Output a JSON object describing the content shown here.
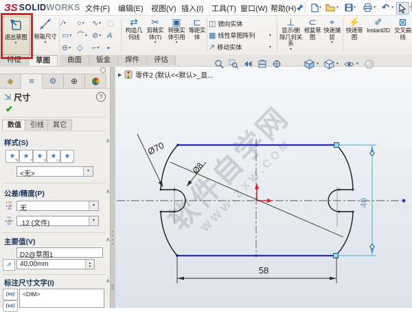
{
  "window": {
    "logo_script": "ЗS",
    "logo_solid": "SOLID",
    "logo_works": "WORKS"
  },
  "menus": {
    "items": [
      {
        "label": "文件(F)"
      },
      {
        "label": "编辑(E)"
      },
      {
        "label": "视图(V)"
      },
      {
        "label": "插入(I)"
      },
      {
        "label": "工具(T)"
      },
      {
        "label": "窗口(W)"
      },
      {
        "label": "帮助(H)"
      }
    ]
  },
  "ribbon": {
    "exit_sketch": {
      "label": "退出草图"
    },
    "smart_dim": {
      "label": "智能尺寸"
    },
    "entity_glyphs": {
      "r1": [
        "∕",
        "○",
        "∿",
        "▢"
      ],
      "r2": [
        "▭",
        "⌒",
        "⊘",
        "A"
      ],
      "r3": [
        "⊖",
        "◇",
        "⌐",
        "▪"
      ]
    },
    "tools": [
      {
        "label": "构造几何线",
        "glyph": "⇄"
      },
      {
        "label": "剪裁实体(T)",
        "glyph": "✂"
      },
      {
        "label": "转换实体引用",
        "glyph": "▣"
      },
      {
        "label": "等距实体",
        "glyph": "⊏"
      }
    ],
    "row_tools": [
      {
        "label": "镜向实体",
        "glyph": "◫"
      },
      {
        "label": "线性草图阵列",
        "glyph": "▦"
      },
      {
        "label": "移动实体",
        "glyph": "↗"
      }
    ],
    "right_tools": [
      {
        "label": "显示/删除几何关系",
        "glyph": "⊥"
      },
      {
        "label": "修复草图",
        "glyph": "⊂"
      },
      {
        "label": "快速捕捉",
        "glyph": "⌖"
      },
      {
        "label": "快速草图",
        "glyph": "⚡"
      },
      {
        "label": "Instant2D",
        "glyph": "✐"
      },
      {
        "label": "交叉曲线",
        "glyph": "⊠"
      }
    ],
    "tabs": [
      {
        "label": "特征"
      },
      {
        "label": "草图"
      },
      {
        "label": "曲面"
      },
      {
        "label": "钣金"
      },
      {
        "label": "焊件"
      },
      {
        "label": "评估"
      }
    ]
  },
  "panel": {
    "title": "尺寸",
    "help": "?",
    "ok": "✔",
    "tabs": [
      {
        "label": "数值"
      },
      {
        "label": "引线"
      },
      {
        "label": "其它"
      }
    ],
    "style": {
      "label": "样式(S)",
      "collapse": "∧",
      "dropdown": "<无>",
      "buttons": [
        {
          "badge": "✎"
        },
        {
          "badge": "+"
        },
        {
          "badge": "×"
        },
        {
          "badge": "▭"
        },
        {
          "badge": "↓"
        }
      ]
    },
    "tolerance": {
      "label": "公差/精度(P)",
      "collapse": "∧",
      "row1": "无",
      "row2": ".12 (文件)",
      "icon1_top": "+.01",
      "icon1_mid": "1.50",
      "icon1_bot": "-.01",
      "icon2_top": ".01",
      "icon2_mid": "1.001",
      "icon2_bot": ".01"
    },
    "primary": {
      "label": "主要值(V)",
      "collapse": "∧",
      "name": "D2@草图1",
      "value": "40.00mm"
    },
    "dim_text": {
      "label": "标注尺寸文字(I)",
      "collapse": "∧",
      "content": "<DIM>",
      "btn1": "(xx)",
      "btn2": "(xx)"
    }
  },
  "canvas": {
    "tree_item": "零件2 (默认<<默认>_显...",
    "watermark_cn": "软件自学网",
    "watermark_en": "WWW.ZXW.COM",
    "dims": {
      "d70": "Ø70",
      "d8": "Ø8",
      "v40": "40",
      "h58": "58"
    }
  },
  "colors": {
    "sketch_blue": "#2727cf",
    "dim_dark": "#33291f",
    "dim_selected": "#4fa8dc",
    "origin_red": "#e01f1f",
    "annotation_red": "#e31e1e"
  }
}
